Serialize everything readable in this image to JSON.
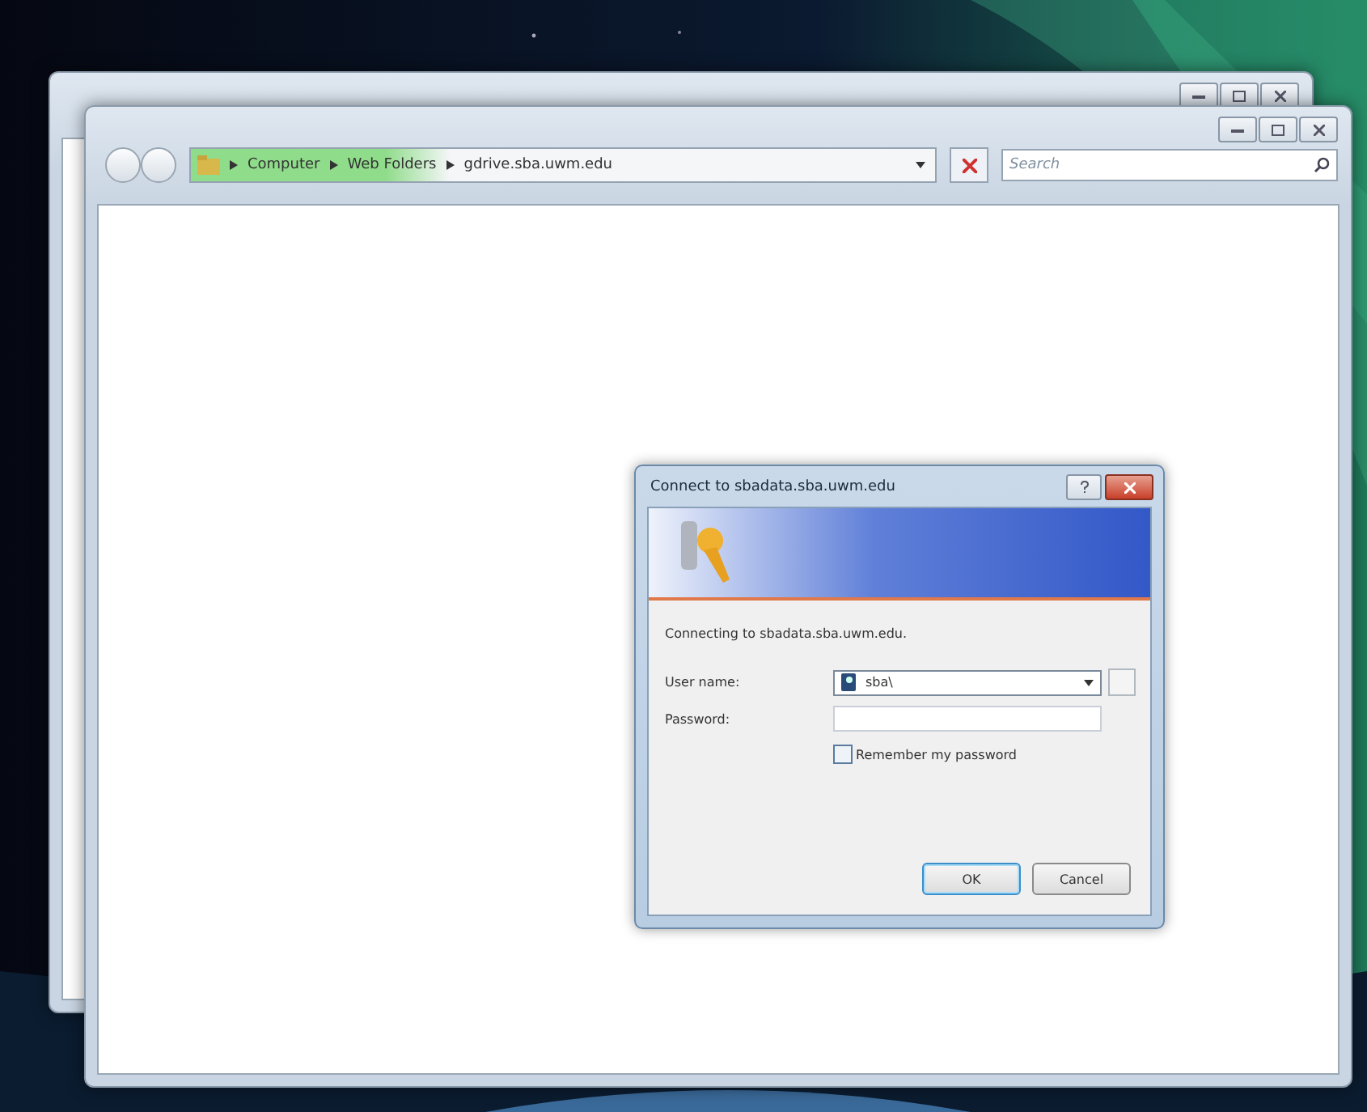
{
  "explorer": {
    "address_bar": {
      "crumbs": [
        {
          "label": "Computer"
        },
        {
          "label": "Web Folders"
        },
        {
          "label": "gdrive.sba.uwm.edu"
        }
      ]
    },
    "search": {
      "placeholder": "Search"
    }
  },
  "dialog": {
    "title": "Connect to sbadata.sba.uwm.edu",
    "message": "Connecting to sbadata.sba.uwm.edu.",
    "fields": [
      {
        "kind": "combo",
        "label": "User name:",
        "value": "sba\\"
      },
      {
        "kind": "password",
        "label": "Password:"
      }
    ],
    "remember": {
      "label": "Remember my password",
      "checked": false
    },
    "buttons": [
      {
        "label": "OK",
        "default": true
      },
      {
        "label": "Cancel",
        "default": false
      }
    ]
  }
}
